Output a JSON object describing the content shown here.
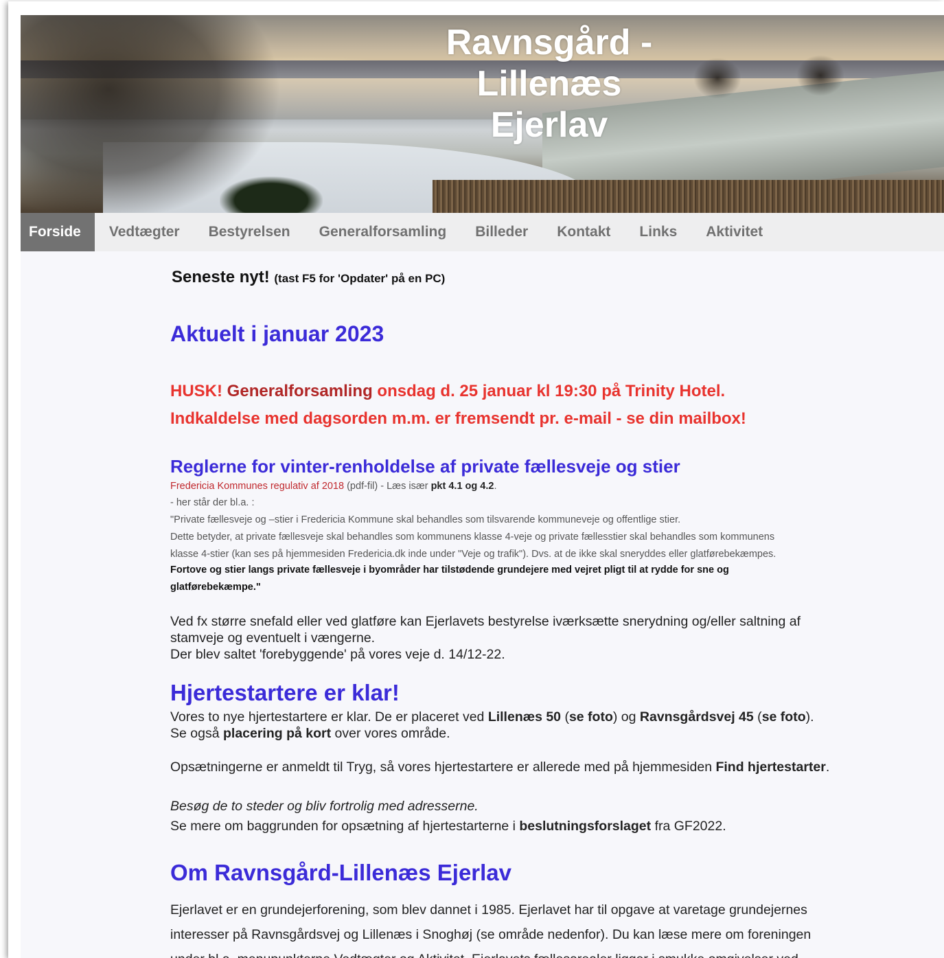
{
  "site": {
    "title_line1": "Ravnsgård -",
    "title_line2": "Lillenæs",
    "title_line3": "Ejerlav"
  },
  "nav": {
    "items": [
      "Forside",
      "Vedtægter",
      "Bestyrelsen",
      "Generalforsamling",
      "Billeder",
      "Kontakt",
      "Links",
      "Aktivitet"
    ],
    "active": "Forside"
  },
  "latest": {
    "label": "Seneste nyt!",
    "hint": "(tast F5 for 'Opdater' på en PC)"
  },
  "january": {
    "heading": "Aktuelt i januar 2023",
    "husk": "HUSK!",
    "gf_link": "Generalforsamling",
    "gf_rest": " onsdag d. 25 januar kl 19:30 på Trinity Hotel.",
    "invite": "Indkaldelse med dagsorden m.m. er fremsendt pr. e-mail - se din mailbox!"
  },
  "winter": {
    "heading": "Reglerne for vinter-renholdelse af private fællesveje og stier",
    "link": "Fredericia Kommunes regulativ af 2018",
    "after_link": " (pdf-fil) - Læs især ",
    "points": "pkt 4.1 og 4.2",
    "points_end": ".",
    "line2": "- her står der bl.a. :",
    "line3": "\"Private fællesveje og –stier i Fredericia Kommune skal behandles som tilsvarende kommuneveje og offentlige stier.",
    "line4": "Dette betyder, at private fællesveje skal behandles som kommunens klasse 4-veje og private fællesstier skal behandles som kommunens",
    "line5": "klasse 4-stier (kan ses på hjemmesiden Fredericia.dk inde under \"Veje og trafik\"). Dvs. at de ikke skal sneryddes eller glatførebekæmpes.",
    "line6": "Fortove og stier langs private fællesveje i byområder har tilstødende grundejere med vejret pligt til at rydde for sne og",
    "line7": "glatførebekæmpe.\"",
    "para1": "Ved fx større snefald eller ved glatføre kan Ejerlavets bestyrelse iværksætte snerydning og/eller saltning af",
    "para2": "stamveje og eventuelt i vængerne.",
    "para3": "Der blev saltet 'forebyggende' på vores veje d. 14/12-22."
  },
  "heart": {
    "heading": "Hjertestartere er klar!",
    "l1a": "Vores to nye hjertestartere er klar. De er placeret ved ",
    "l1b": "Lillenæs 50",
    "l1c": " (",
    "l1link1": "se foto",
    "l1d": ") og ",
    "l1e": "Ravnsgårdsvej 45",
    "l1f": " (",
    "l1link2": "se foto",
    "l1g": ").",
    "l2a": "Se også ",
    "l2link": "placering på kort",
    "l2b": " over vores område.",
    "l3a": "Opsætningerne er anmeldt til Tryg, så vores hjertestartere er allerede med på hjemmesiden ",
    "l3link": "Find hjertestarter",
    "l3b": ".",
    "l4": "Besøg de to steder og bliv fortrolig med adresserne.",
    "l5a": "Se mere om baggrunden for opsætning af hjertestarterne i ",
    "l5link": "beslutningsforslaget",
    "l5b": " fra GF2022."
  },
  "about": {
    "heading": "Om Ravnsgård-Lillenæs Ejerlav",
    "l1": "Ejerlavet er en grundejerforening, som blev dannet i 1985. Ejerlavet har til opgave at varetage grundejernes",
    "l2": "interesser på Ravnsgårdsvej og Lillenæs i Snoghøj (se område nedenfor). Du kan læse mere om foreningen",
    "l3": "under bl.a. menupunkterne Vedtægter og Aktivitet. Ejerlavets fællesarealer ligger i smukke omgivelser ved"
  },
  "colors": {
    "heading_blue": "#3b2bd8",
    "alert_red": "#e8332e",
    "nav_active_bg": "#727272"
  }
}
